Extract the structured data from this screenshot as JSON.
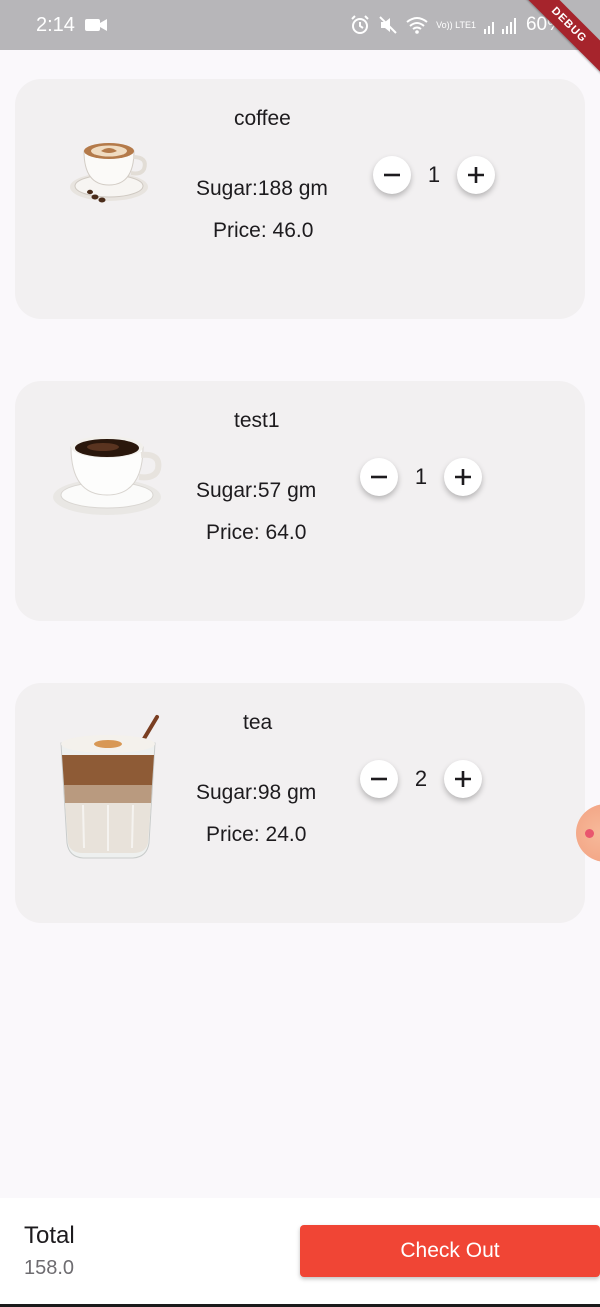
{
  "status_bar": {
    "time": "2:14",
    "battery": "60%",
    "network_label": "Vo)) LTE1",
    "debug_label": "DEBUG"
  },
  "cart": {
    "items": [
      {
        "name": "coffee",
        "sugar": "Sugar:188 gm",
        "price": "Price: 46.0",
        "quantity": "1",
        "image_icon": "cappuccino-cup-icon"
      },
      {
        "name": "test1",
        "sugar": "Sugar:57 gm",
        "price": "Price: 64.0",
        "quantity": "1",
        "image_icon": "black-coffee-cup-icon"
      },
      {
        "name": "tea",
        "sugar": "Sugar:98 gm",
        "price": "Price: 24.0",
        "quantity": "2",
        "image_icon": "latte-glass-icon"
      }
    ]
  },
  "footer": {
    "total_label": "Total",
    "total_value": "158.0",
    "checkout_label": "Check Out"
  },
  "colors": {
    "accent": "#f04535",
    "card_bg": "#f2f0f1",
    "page_bg": "#faf8fb",
    "status_bar_bg": "#b7b6b9"
  }
}
